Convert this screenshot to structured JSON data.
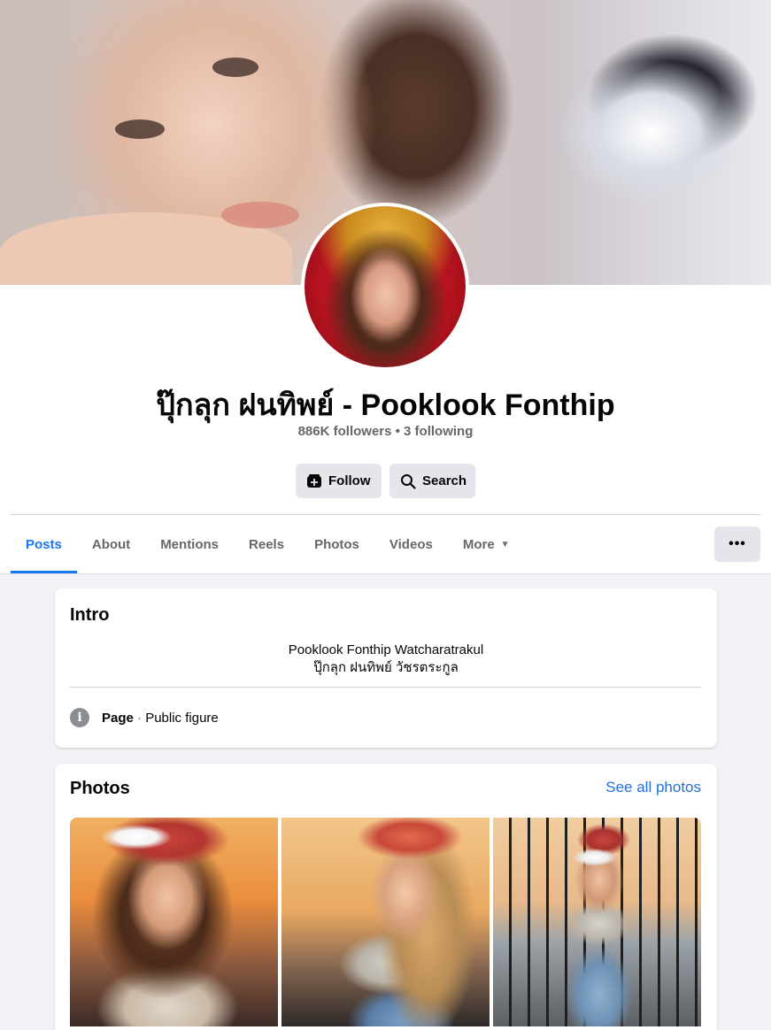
{
  "profile": {
    "name": "ปุ๊กลุก ฝนทิพย์ - Pooklook Fonthip",
    "stats": "886K followers • 3 following"
  },
  "actions": {
    "follow_label": "Follow",
    "search_label": "Search"
  },
  "tabs": [
    {
      "label": "Posts",
      "active": true
    },
    {
      "label": "About"
    },
    {
      "label": "Mentions"
    },
    {
      "label": "Reels"
    },
    {
      "label": "Photos"
    },
    {
      "label": "Videos"
    },
    {
      "label": "More"
    }
  ],
  "more_menu_label": "•••",
  "intro": {
    "title": "Intro",
    "bio_line1": "Pooklook Fonthip Watcharatrakul",
    "bio_line2": "ปุ๊กลุก ฝนทิพย์ วัชรตระกูล",
    "page_type": "Page",
    "separator": " · ",
    "category": "Public figure"
  },
  "photos": {
    "title": "Photos",
    "see_all": "See all photos"
  },
  "icons": {
    "follow": "follow-page-icon",
    "search": "search-icon",
    "info": "info-icon",
    "more": "caret-down-icon"
  },
  "colors": {
    "accent": "#1877f2",
    "link": "#216fdb",
    "button_bg": "#e4e6eb",
    "page_bg": "#f0f2f5",
    "secondary_text": "#65676b"
  }
}
